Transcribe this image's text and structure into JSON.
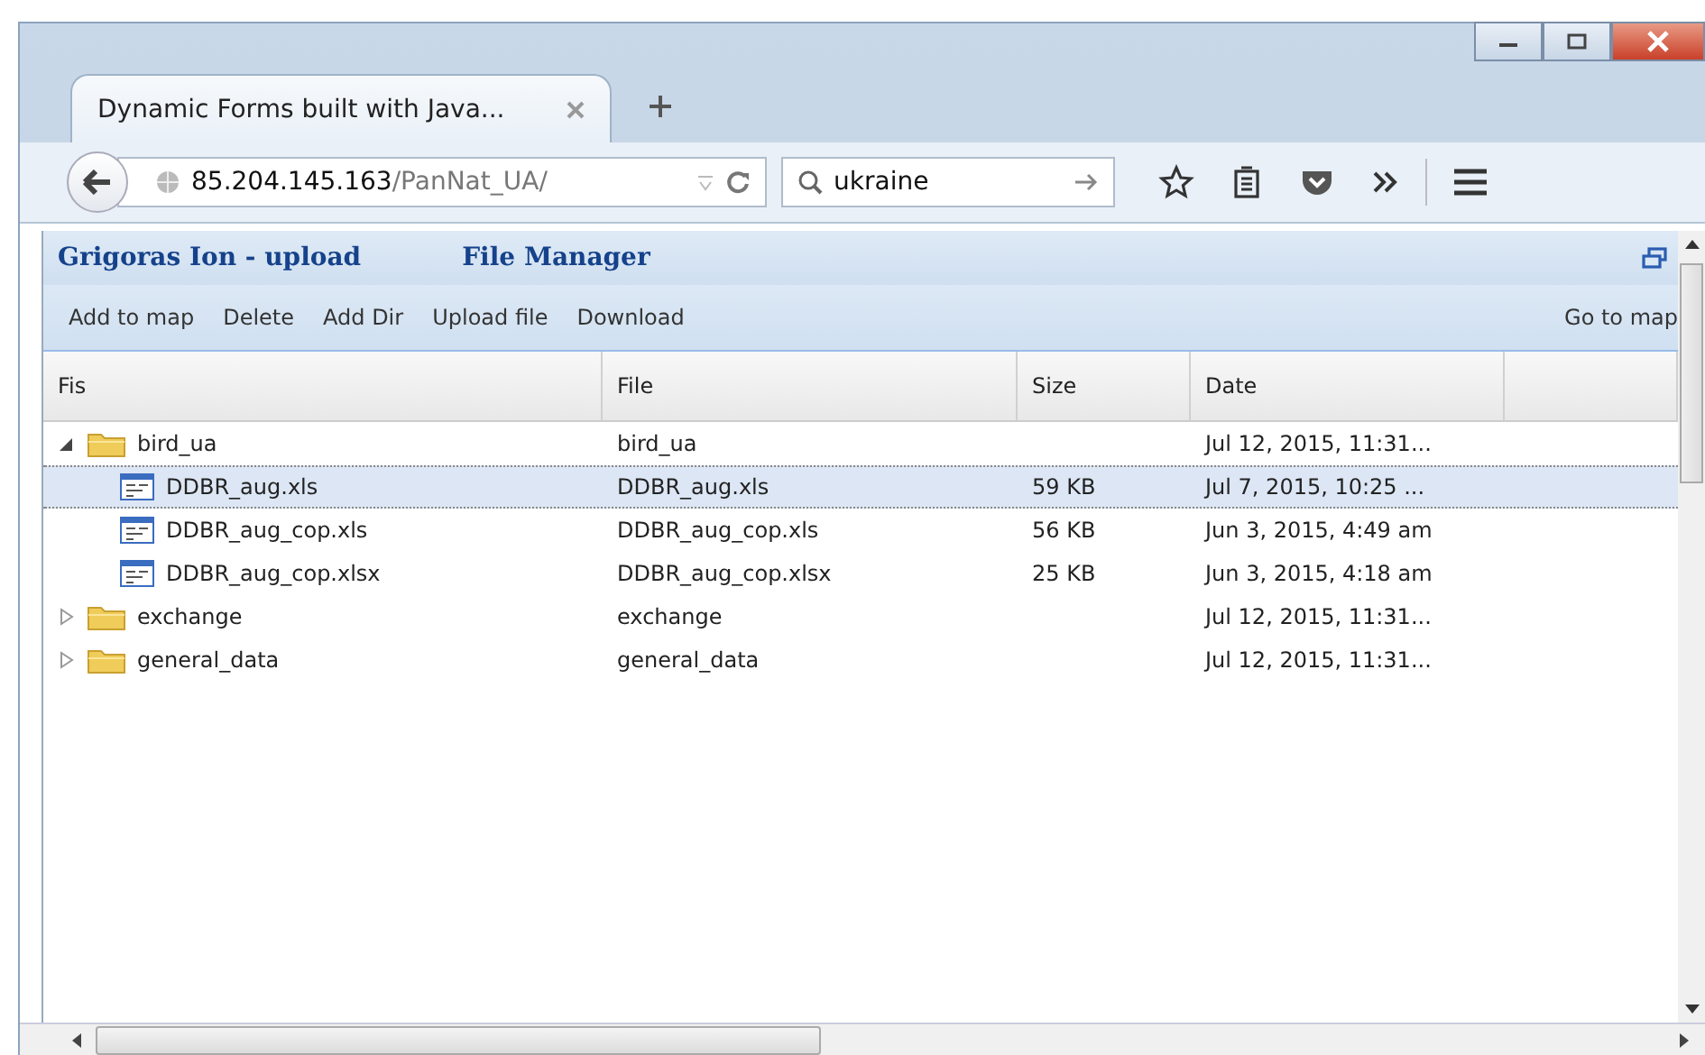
{
  "browser": {
    "tab_title": "Dynamic Forms built with Java...",
    "url_host": "85.204.145.163",
    "url_path": "/PanNat_UA/",
    "search": "ukraine"
  },
  "panel": {
    "user": "Grigoras Ion - upload",
    "title": "File Manager"
  },
  "toolbar": [
    "Add to map",
    "Delete",
    "Add Dir",
    "Upload file",
    "Download"
  ],
  "toolbar_right": "Go to map",
  "columns": [
    "Fis",
    "File",
    "Size",
    "Date"
  ],
  "rows": [
    {
      "kind": "folder",
      "name": "bird_ua",
      "file": "bird_ua",
      "size": "",
      "date": "Jul 12, 2015, 11:31...",
      "expanded": true,
      "selected": false,
      "children": [
        {
          "kind": "file",
          "name": "DDBR_aug.xls",
          "file": "DDBR_aug.xls",
          "size": "59 KB",
          "date": "Jul 7, 2015, 10:25 ...",
          "selected": true
        },
        {
          "kind": "file",
          "name": "DDBR_aug_cop.xls",
          "file": "DDBR_aug_cop.xls",
          "size": "56 KB",
          "date": "Jun 3, 2015, 4:49 am",
          "selected": false
        },
        {
          "kind": "file",
          "name": "DDBR_aug_cop.xlsx",
          "file": "DDBR_aug_cop.xlsx",
          "size": "25 KB",
          "date": "Jun 3, 2015, 4:18 am",
          "selected": false
        }
      ]
    },
    {
      "kind": "folder",
      "name": "exchange",
      "file": "exchange",
      "size": "",
      "date": "Jul 12, 2015, 11:31...",
      "expanded": false,
      "selected": false
    },
    {
      "kind": "folder",
      "name": "general_data",
      "file": "general_data",
      "size": "",
      "date": "Jul 12, 2015, 11:31...",
      "expanded": false,
      "selected": false
    }
  ]
}
